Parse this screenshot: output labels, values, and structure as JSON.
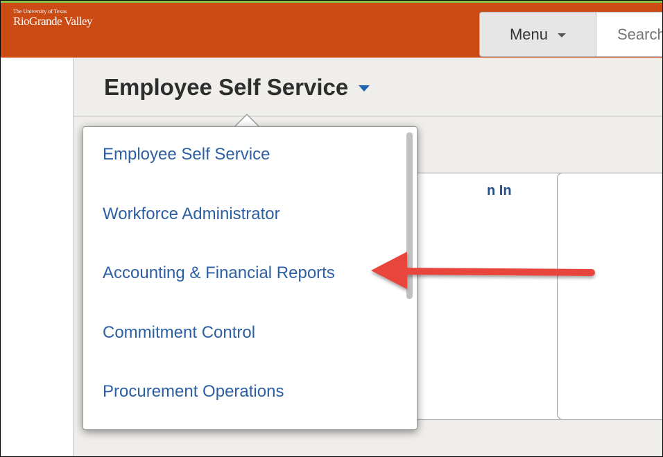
{
  "brand": {
    "line1": "The University of Texas",
    "line2": "RioGrande Valley"
  },
  "header": {
    "menu_label": "Menu",
    "search_placeholder": "Search"
  },
  "page": {
    "title": "Employee Self Service"
  },
  "tile": {
    "title_fragment": "n In"
  },
  "dropdown": {
    "items": [
      "Employee Self Service",
      "Workforce Administrator",
      "Accounting & Financial Reports",
      "Commitment Control",
      "Procurement Operations"
    ]
  },
  "colors": {
    "brand_orange": "#cc4a14",
    "top_stripe": "#8bc34a",
    "link_blue": "#2c5fa3",
    "annotation_arrow": "#e8453c"
  }
}
